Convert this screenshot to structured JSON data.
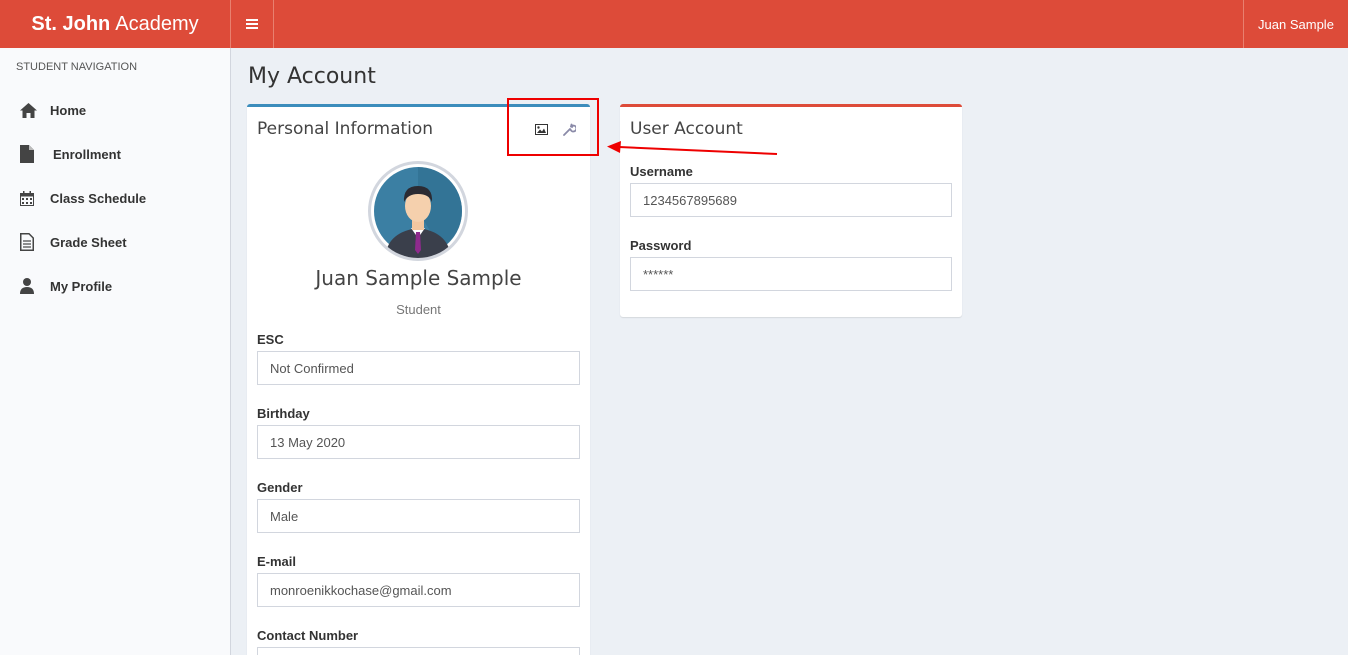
{
  "app": {
    "brand_bold": "St. John",
    "brand_rest": "Academy",
    "user_name": "Juan Sample"
  },
  "sidebar": {
    "header": "STUDENT NAVIGATION",
    "items": [
      {
        "label": "Home",
        "icon": "home-icon"
      },
      {
        "label": "Enrollment",
        "icon": "file-icon"
      },
      {
        "label": "Class Schedule",
        "icon": "calendar-icon"
      },
      {
        "label": "Grade Sheet",
        "icon": "document-icon"
      },
      {
        "label": "My Profile",
        "icon": "user-icon"
      }
    ]
  },
  "page": {
    "title": "My Account"
  },
  "personal": {
    "title": "Personal Information",
    "tools": [
      "image-icon",
      "wrench-icon"
    ],
    "name": "Juan Sample Sample",
    "role": "Student",
    "fields": [
      {
        "label": "ESC",
        "value": "Not Confirmed"
      },
      {
        "label": "Birthday",
        "value": "13 May 2020"
      },
      {
        "label": "Gender",
        "value": "Male"
      },
      {
        "label": "E-mail",
        "value": "monroenikkochase@gmail.com"
      },
      {
        "label": "Contact Number",
        "value": ""
      }
    ]
  },
  "account": {
    "title": "User Account",
    "username_label": "Username",
    "username_value": "1234567895689",
    "password_label": "Password",
    "password_value": "******"
  },
  "colors": {
    "header": "#dd4b39",
    "personal_border": "#3c8dbc",
    "account_border": "#dd4b39",
    "annotation": "#ee0000"
  }
}
